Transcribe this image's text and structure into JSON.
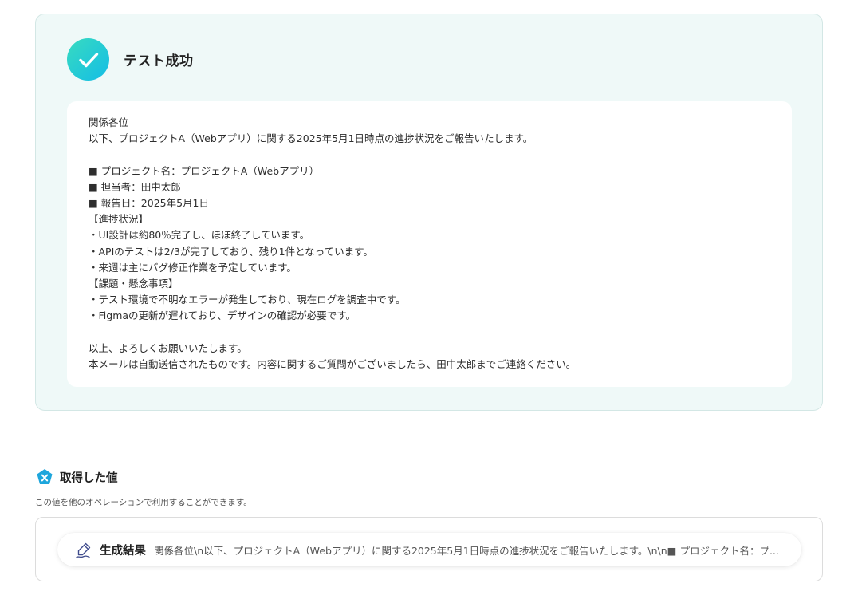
{
  "success": {
    "title": "テスト成功",
    "icon": "check-icon",
    "accent_start": "#38dbc0",
    "accent_end": "#14bde6",
    "message_lines": [
      "関係各位",
      "以下、プロジェクトA（Webアプリ）に関する2025年5月1日時点の進捗状況をご報告いたします。",
      "",
      "■ プロジェクト名：プロジェクトA（Webアプリ）",
      "■ 担当者：田中太郎",
      "■ 報告日：2025年5月1日",
      "【進捗状況】",
      "・UI設計は約80％完了し、ほぼ終了しています。",
      "・APIのテストは2/3が完了しており、残り1件となっています。",
      "・来週は主にバグ修正作業を予定しています。",
      "【課題・懸念事項】",
      "・テスト環境で不明なエラーが発生しており、現在ログを調査中です。",
      "・Figmaの更新が遅れており、デザインの確認が必要です。",
      "",
      "以上、よろしくお願いいたします。",
      "本メールは自動送信されたものです。内容に関するご質問がございましたら、田中太郎までご連絡ください。"
    ]
  },
  "values_section": {
    "icon": "x-variable-icon",
    "title": "取得した値",
    "description": "この値を他のオペレーションで利用することができます。",
    "items": [
      {
        "icon": "pen-icon",
        "label": "生成結果",
        "value": "関係各位\\n以下、プロジェクトA（Webアプリ）に関する2025年5月1日時点の進捗状況をご報告いたします。\\n\\n■ プロジェクト名：プ..."
      }
    ]
  }
}
